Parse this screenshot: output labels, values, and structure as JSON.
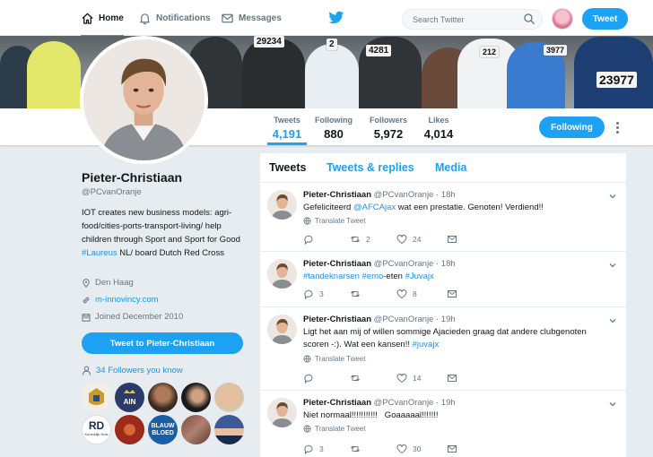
{
  "nav": {
    "home": "Home",
    "notifications": "Notifications",
    "messages": "Messages",
    "search_placeholder": "Search Twitter",
    "tweet_button": "Tweet"
  },
  "banner": {
    "bibs": [
      "29234",
      "4281",
      "2",
      "3977",
      "23977",
      "212"
    ]
  },
  "stats": [
    {
      "label": "Tweets",
      "value": "4,191"
    },
    {
      "label": "Following",
      "value": "880"
    },
    {
      "label": "Followers",
      "value": "5,972"
    },
    {
      "label": "Likes",
      "value": "4,014"
    }
  ],
  "following_button": "Following",
  "profile": {
    "name": "Pieter-Christiaan",
    "handle": "@PCvanOranje",
    "bio_part1": "IOT creates new business models: agri-food/cities-ports-transport-living/ help children through Sport and Sport for Good ",
    "bio_link": "#Laureus",
    "bio_part2": " NL/ board Dutch Red Cross",
    "location": "Den Haag",
    "website": "m-innovincy.com",
    "joined": "Joined December 2010",
    "tweet_to": "Tweet to Pieter-Christiaan",
    "followers_you_know": "34 Followers you know"
  },
  "followers_known": [
    {
      "label": "",
      "color": "#c99b2a"
    },
    {
      "label": "AIN",
      "color": "#2b3a66"
    },
    {
      "label": "",
      "color": "#5a3a2a"
    },
    {
      "label": "",
      "color": "#2a2a2a"
    },
    {
      "label": "",
      "color": "#d8c2a8"
    },
    {
      "label": "RD",
      "sub": "Koninklijk Huis",
      "color": "#ffffff"
    },
    {
      "label": "",
      "color": "#9e2a1a"
    },
    {
      "label": "BLAUW BLOED",
      "color": "#1a5ea8"
    },
    {
      "label": "",
      "color": "#7a4a3a"
    },
    {
      "label": "",
      "color": "#3a5a9a"
    }
  ],
  "timeline": {
    "tabs": [
      "Tweets",
      "Tweets & replies",
      "Media"
    ],
    "translate_label": "Translate Tweet",
    "tweets": [
      {
        "name": "Pieter-Christiaan",
        "handle": "@PCvanOranje · 18h",
        "text_parts": [
          {
            "t": "Gefeliciteerd ",
            "link": false
          },
          {
            "t": "@AFCAjax",
            "link": true
          },
          {
            "t": " wat een prestatie. Genoten! Verdiend!!",
            "link": false
          }
        ],
        "translate": true,
        "replies": "",
        "retweets": "2",
        "likes": "24"
      },
      {
        "name": "Pieter-Christiaan",
        "handle": "@PCvanOranje · 18h",
        "text_parts": [
          {
            "t": "#tandeknarsen",
            "link": true
          },
          {
            "t": " ",
            "link": false
          },
          {
            "t": "#emo",
            "link": true
          },
          {
            "t": "-eten ",
            "link": false
          },
          {
            "t": "#Juvajx",
            "link": true
          }
        ],
        "translate": false,
        "replies": "3",
        "retweets": "",
        "likes": "8"
      },
      {
        "name": "Pieter-Christiaan",
        "handle": "@PCvanOranje · 19h",
        "text_parts": [
          {
            "t": "Ligt het aan mij of willen sommige Ajacieden graag dat andere clubgenoten scoren -:). Wat een kansen!! ",
            "link": false
          },
          {
            "t": "#juvajx",
            "link": true
          }
        ],
        "translate": true,
        "replies": "",
        "retweets": "",
        "likes": "14"
      },
      {
        "name": "Pieter-Christiaan",
        "handle": "@PCvanOranje · 19h",
        "text_parts": [
          {
            "t": "Niet normaal!!!!!!!!!!!   Goaaaaal!!!!!!!",
            "link": false
          }
        ],
        "translate": true,
        "replies": "3",
        "retweets": "",
        "likes": "30"
      }
    ]
  },
  "colors": {
    "accent": "#1da1f2",
    "link": "#1b95e0",
    "background": "#e6ecf0",
    "muted": "#657786"
  }
}
